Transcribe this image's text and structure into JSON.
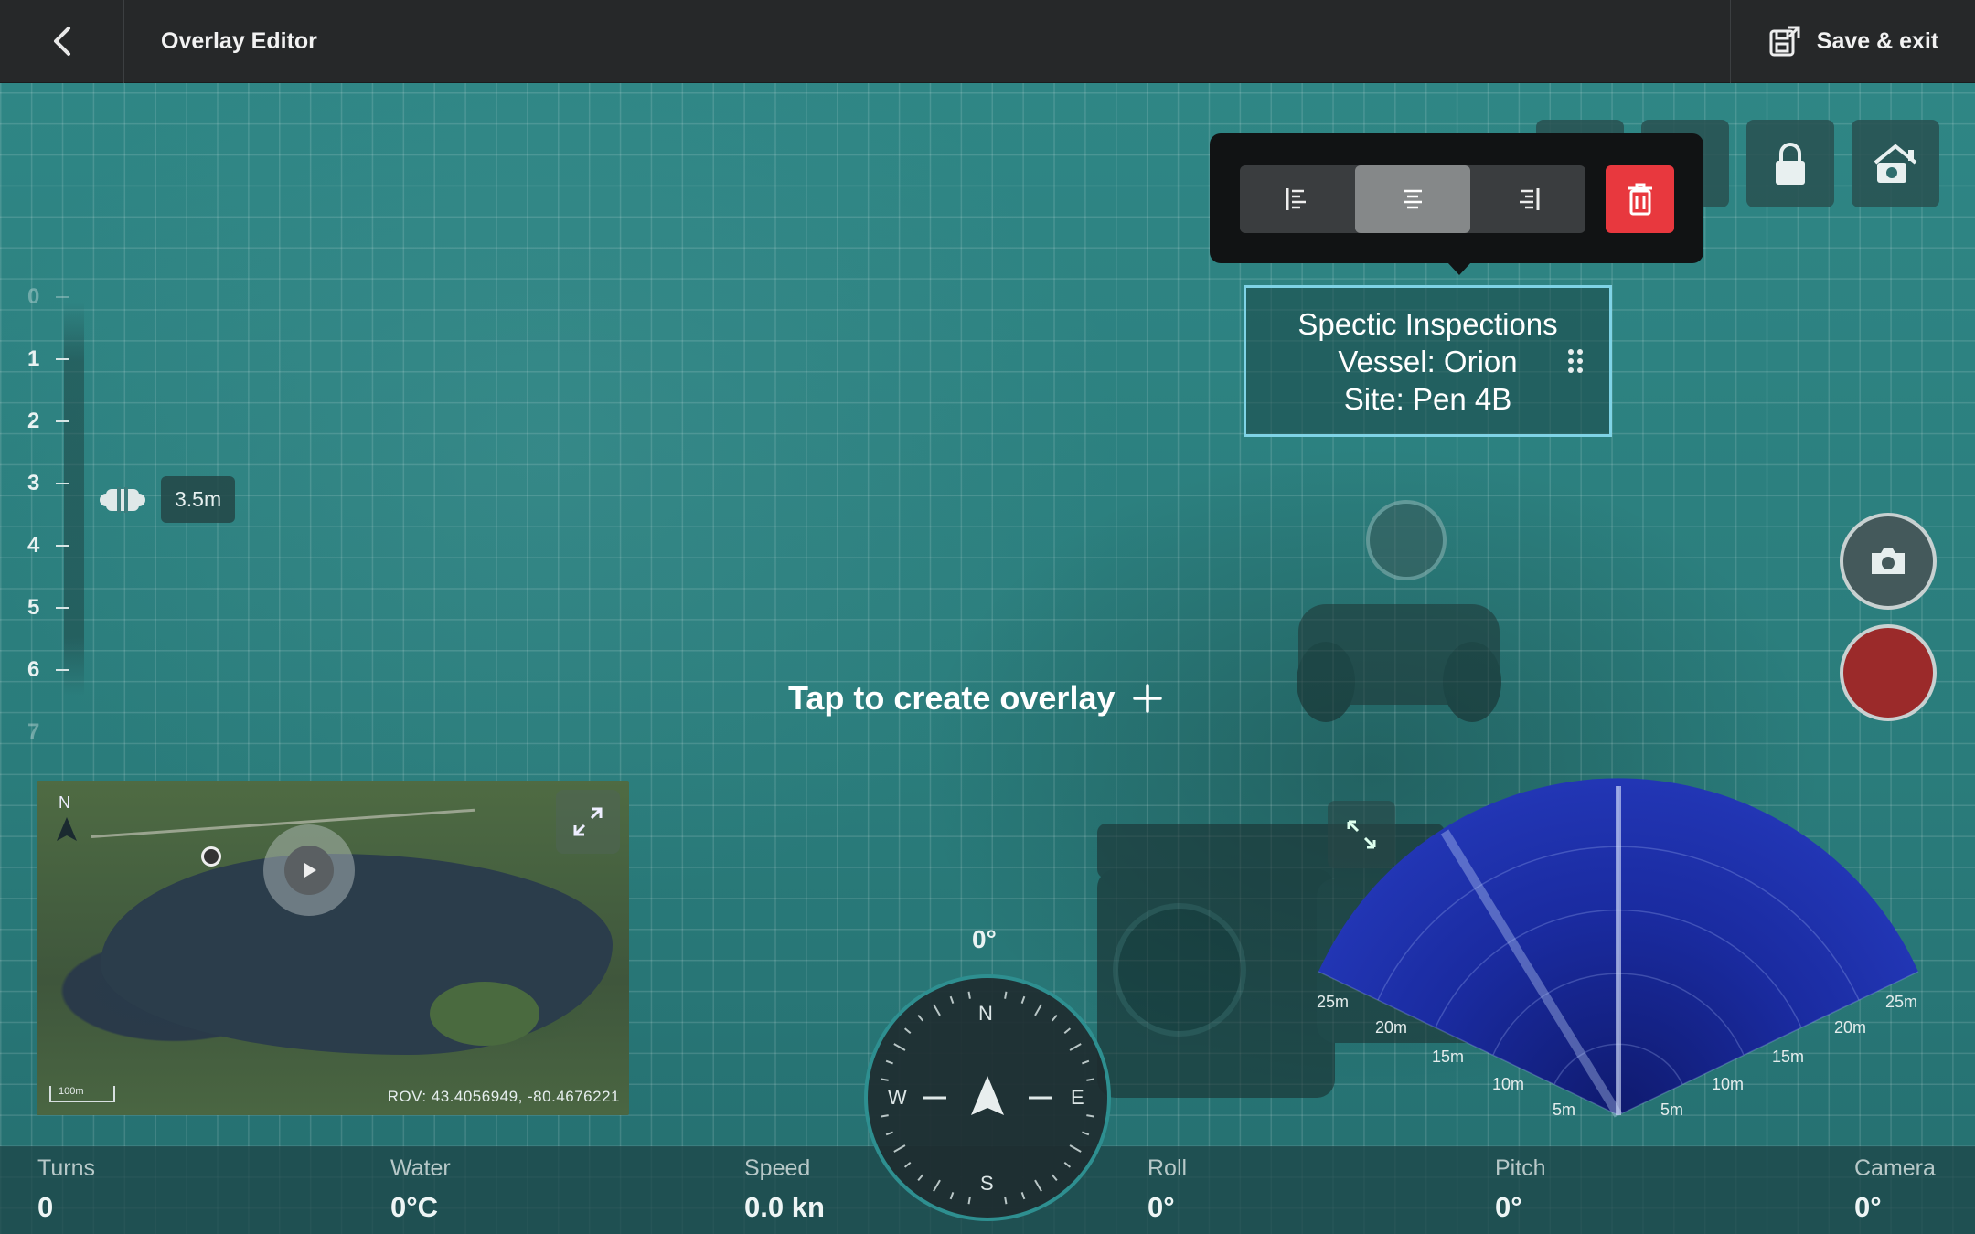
{
  "header": {
    "title": "Overlay Editor",
    "save_label": "Save & exit"
  },
  "depth": {
    "ticks": [
      "0",
      "1",
      "2",
      "3",
      "4",
      "5",
      "6",
      "7"
    ],
    "current": "3.5m"
  },
  "overlay": {
    "line1": "Spectic Inspections",
    "line2": "Vessel: Orion",
    "line3": "Site: Pen 4B",
    "alignment": "center"
  },
  "canvas": {
    "tap_hint": "Tap to create overlay"
  },
  "map": {
    "north": "N",
    "scale": "100m",
    "coords": "ROV: 43.4056949, -80.4676221"
  },
  "compass": {
    "heading": "0°",
    "n": "N",
    "e": "E",
    "s": "S",
    "w": "W"
  },
  "sonar": {
    "range_labels": [
      "25m",
      "20m",
      "15m",
      "10m",
      "5m"
    ]
  },
  "telemetry": {
    "turns": {
      "label": "Turns",
      "value": "0"
    },
    "water": {
      "label": "Water",
      "value": "0°C"
    },
    "speed": {
      "label": "Speed",
      "value": "0.0 kn"
    },
    "roll": {
      "label": "Roll",
      "value": "0°"
    },
    "pitch": {
      "label": "Pitch",
      "value": "0°"
    },
    "camera": {
      "label": "Camera",
      "value": "0°"
    }
  },
  "colors": {
    "accent_delete": "#e8383e",
    "record": "#9b2a2a",
    "overlay_border": "#7fd3e6",
    "sonar": "#1c2fa8"
  }
}
